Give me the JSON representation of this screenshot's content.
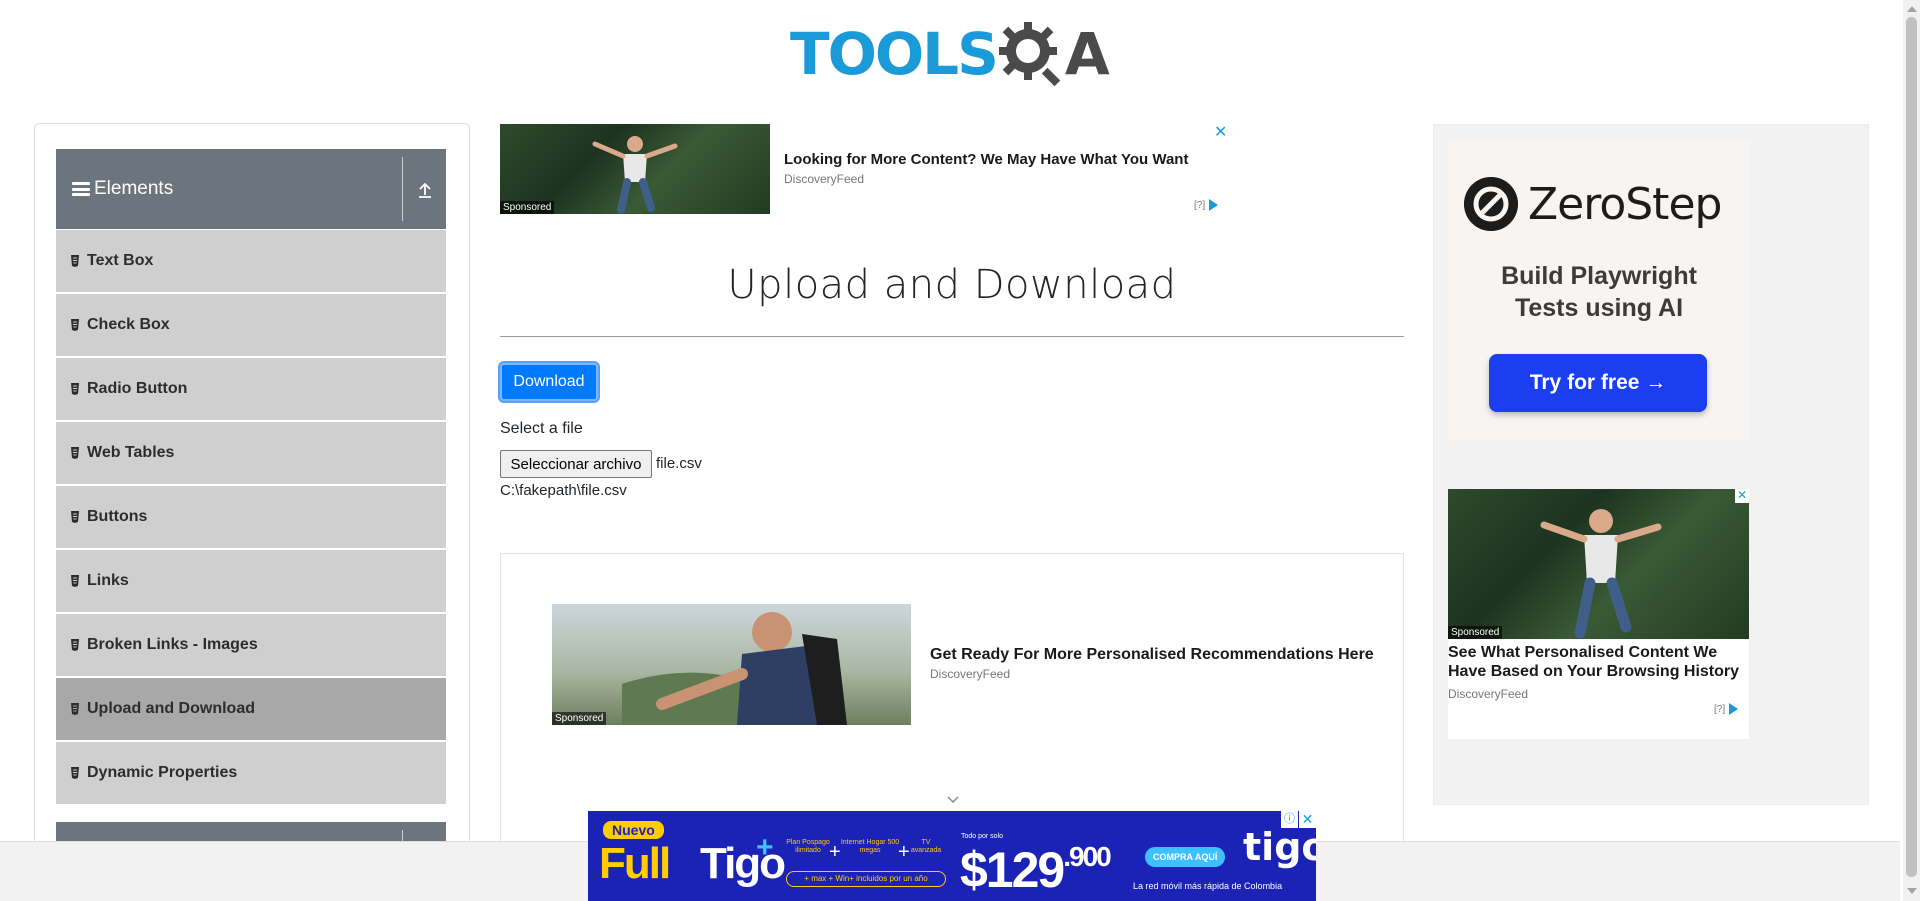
{
  "logo": {
    "part1": "TOOLS",
    "part2": "A"
  },
  "sidebar": {
    "group_title": "Elements",
    "items": [
      {
        "label": "Text Box",
        "active": false
      },
      {
        "label": "Check Box",
        "active": false
      },
      {
        "label": "Radio Button",
        "active": false
      },
      {
        "label": "Web Tables",
        "active": false
      },
      {
        "label": "Buttons",
        "active": false
      },
      {
        "label": "Links",
        "active": false
      },
      {
        "label": "Broken Links - Images",
        "active": false
      },
      {
        "label": "Upload and Download",
        "active": true
      },
      {
        "label": "Dynamic Properties",
        "active": false
      }
    ]
  },
  "top_ad": {
    "headline": "Looking for More Content? We May Have What You Want",
    "source": "DiscoveryFeed",
    "sponsored": "Sponsored",
    "adchoices": "[?]",
    "close": "✕"
  },
  "main": {
    "title": "Upload and Download",
    "download_label": "Download",
    "select_label": "Select a file",
    "file_button_label": "Seleccionar archivo",
    "file_name": "file.csv",
    "uploaded_path": "C:\\fakepath\\file.csv"
  },
  "mid_ad": {
    "headline": "Get Ready For More Personalised Recommendations Here",
    "source": "DiscoveryFeed",
    "sponsored": "Sponsored"
  },
  "zerostep_ad": {
    "brand": "ZeroStep",
    "tagline_line1": "Build Playwright",
    "tagline_line2": "Tests using AI",
    "cta": "Try for free →"
  },
  "right_ad": {
    "headline": "See What Personalised Content We Have Based on Your Browsing History",
    "source": "DiscoveryFeed",
    "sponsored": "Sponsored",
    "adchoices": "[?]"
  },
  "tigo_ad": {
    "badge": "Nuevo",
    "full": "Full",
    "tigo": "Tigo",
    "plus": "+",
    "feature1": "Plan Pospago ilimitado",
    "feature2": "Internet Hogar 500 megas",
    "feature3": "TV avanzada",
    "included": "+ max + Win+ incluidos por un año",
    "price_prefix": "Todo por solo",
    "price_main": "$129",
    "price_cents": ".900",
    "cta": "COMPRA AQUÍ",
    "brand": "tigo",
    "slogan": "La red móvil más rápida de Colombia",
    "close": "✕",
    "info": "ⓘ"
  },
  "colors": {
    "accent": "#007bff",
    "logo_blue": "#1a9bd7",
    "sidebar_header": "#6c757d",
    "sidebar_item": "#cfcfcf",
    "sidebar_active": "#a8a8a8",
    "tigo_blue": "#1a23b5",
    "tigo_yellow": "#ffcd00"
  }
}
